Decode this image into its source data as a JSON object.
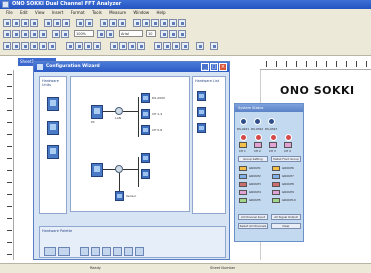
{
  "window": {
    "title": "ONO SOKKI  Dual Channel FFT Analyzer"
  },
  "menu": [
    "File",
    "Edit",
    "View",
    "Insert",
    "Format",
    "Tools",
    "Measure",
    "Window",
    "Help"
  ],
  "toolbar": {
    "zoom": "100%",
    "font": "Arial",
    "size": "10"
  },
  "document": {
    "tab": "Sheet1",
    "logo": "ONO SOKKI"
  },
  "config_dialog": {
    "title": "Configuration Wizard",
    "left_panel_label": "Hardware Units",
    "right_panel_label": "Hardware List",
    "palette_label": "Hardware Palette",
    "nodes": [
      {
        "label": "PC"
      },
      {
        "label": "LAN"
      },
      {
        "label": "DS-2000"
      },
      {
        "label": "CH 1-4"
      },
      {
        "label": "CH 5-8"
      },
      {
        "label": "Sensor"
      }
    ]
  },
  "status_panel": {
    "title": "System Status",
    "units": [
      "DS-0221",
      "DS-0322",
      "DS-0323"
    ],
    "channels": [
      "CH 1",
      "CH 2",
      "CH 3",
      "CH 4"
    ],
    "group_button": "Group Setting",
    "detail_button": "Detail Front Group",
    "groups": [
      {
        "name": "GROUP1",
        "color": "#f2c04a"
      },
      {
        "name": "GROUP2",
        "color": "#7fb0e8"
      },
      {
        "name": "GROUP3",
        "color": "#cc6e6e"
      },
      {
        "name": "GROUP4",
        "color": "#e3a2d6"
      },
      {
        "name": "GROUP5",
        "color": "#9fd68a"
      }
    ],
    "groups_right": [
      {
        "name": "GROUP6",
        "color": "#f2c04a"
      },
      {
        "name": "GROUP7",
        "color": "#7fb0e8"
      },
      {
        "name": "GROUP8",
        "color": "#cc6e6e"
      },
      {
        "name": "GROUP9",
        "color": "#e3a2d6"
      },
      {
        "name": "GROUP10",
        "color": "#9fd68a"
      }
    ],
    "bottom_buttons": [
      "All Channel Input",
      "All Signal Output",
      "Select All Channels",
      "Clear"
    ]
  },
  "statusbar": {
    "left": "Ready",
    "right": "Sheet Number"
  }
}
